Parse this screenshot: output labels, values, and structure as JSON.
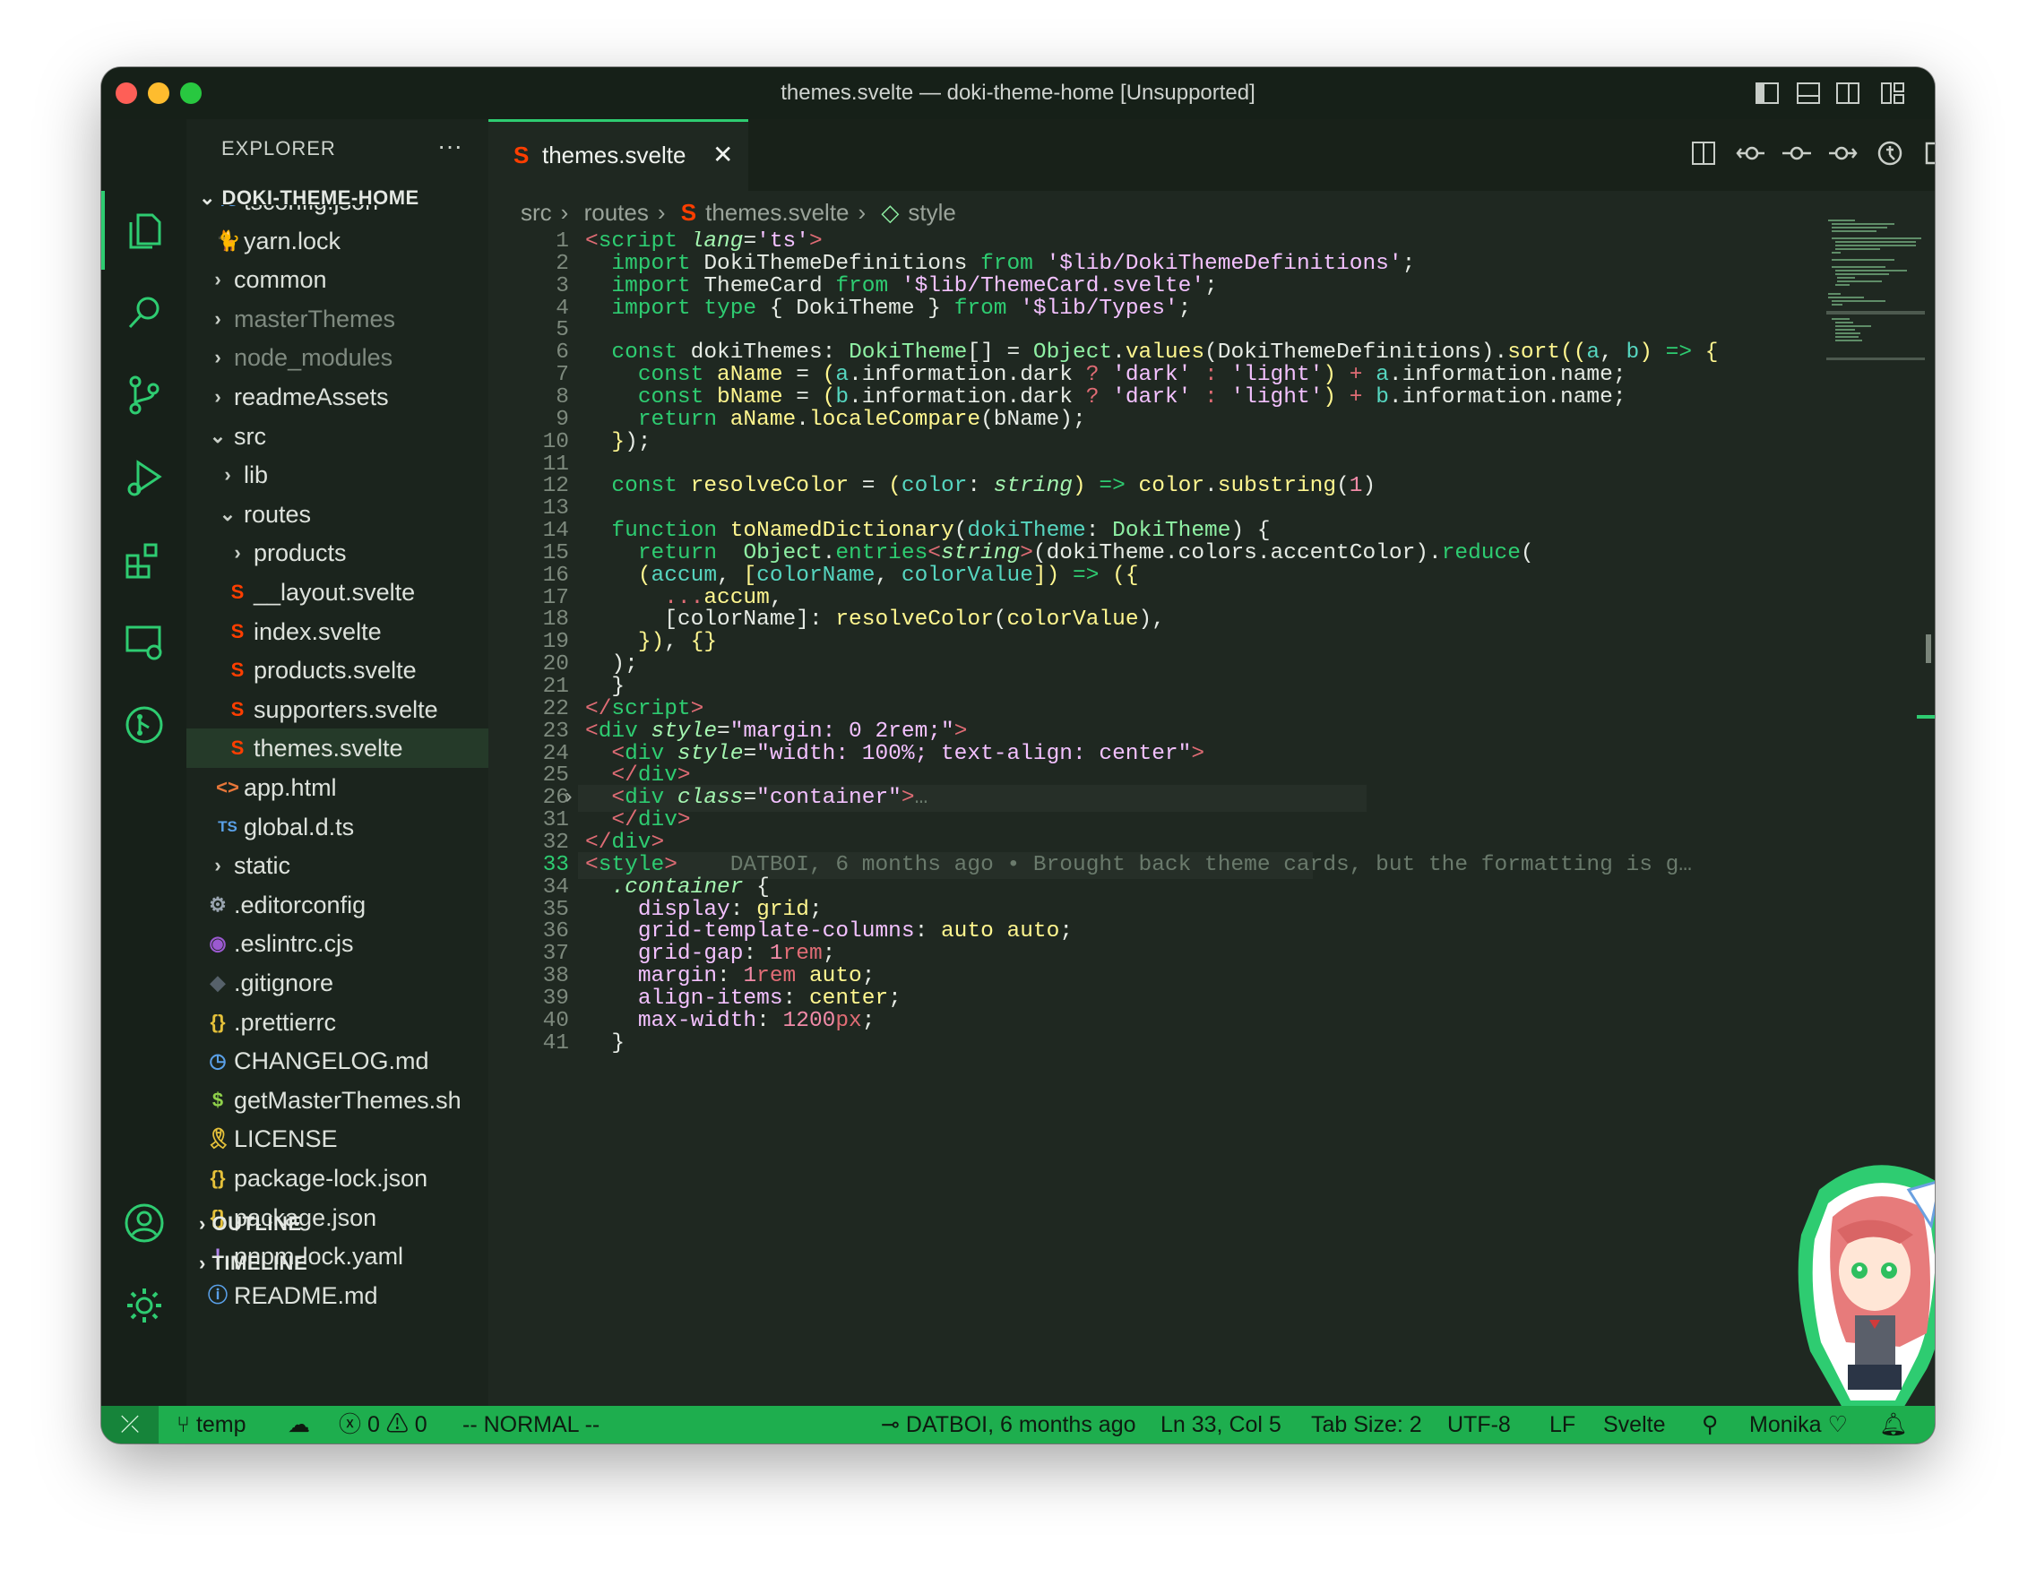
{
  "window": {
    "title": "themes.svelte — doki-theme-home [Unsupported]"
  },
  "colors": {
    "accent": "#2ecc71",
    "status_bar": "#1eae4e",
    "background": "#1f2821"
  },
  "activity_bar": {
    "items": [
      "files-icon",
      "search-icon",
      "source-control-icon",
      "run-debug-icon",
      "extensions-icon",
      "remote-explorer-icon",
      "git-graph-icon"
    ],
    "bottom": [
      "account-icon",
      "settings-gear-icon"
    ]
  },
  "sidebar": {
    "title": "EXPLORER",
    "more": "···",
    "root": "DOKI-THEME-HOME",
    "items": [
      {
        "label": "tsconfig.json",
        "icon": "TS",
        "indent": 1,
        "color": "#5aa0e8"
      },
      {
        "label": "yarn.lock",
        "icon": "🐈",
        "indent": 1,
        "color": "#3c8dd8"
      },
      {
        "label": "common",
        "icon": "›",
        "indent": 0,
        "color": "#c9cfc8"
      },
      {
        "label": "masterThemes",
        "icon": "›",
        "indent": 0,
        "color": "#c9cfc8",
        "dim": true
      },
      {
        "label": "node_modules",
        "icon": "›",
        "indent": 0,
        "color": "#c9cfc8",
        "dim": true
      },
      {
        "label": "readmeAssets",
        "icon": "›",
        "indent": 0,
        "color": "#c9cfc8"
      },
      {
        "label": "src",
        "icon": "⌄",
        "indent": 0,
        "color": "#c9cfc8"
      },
      {
        "label": "lib",
        "icon": "›",
        "indent": 1,
        "color": "#c9cfc8"
      },
      {
        "label": "routes",
        "icon": "⌄",
        "indent": 1,
        "color": "#c9cfc8"
      },
      {
        "label": "products",
        "icon": "›",
        "indent": 2,
        "color": "#c9cfc8"
      },
      {
        "label": "__layout.svelte",
        "icon": "S",
        "indent": 2,
        "color": "#ff3e00"
      },
      {
        "label": "index.svelte",
        "icon": "S",
        "indent": 2,
        "color": "#ff3e00"
      },
      {
        "label": "products.svelte",
        "icon": "S",
        "indent": 2,
        "color": "#ff3e00"
      },
      {
        "label": "supporters.svelte",
        "icon": "S",
        "indent": 2,
        "color": "#ff3e00"
      },
      {
        "label": "themes.svelte",
        "icon": "S",
        "indent": 2,
        "color": "#ff3e00",
        "selected": true
      },
      {
        "label": "app.html",
        "icon": "<>",
        "indent": 1,
        "color": "#e8773a"
      },
      {
        "label": "global.d.ts",
        "icon": "TS",
        "indent": 1,
        "color": "#5aa0e8"
      },
      {
        "label": "static",
        "icon": "›",
        "indent": 0,
        "color": "#c9cfc8"
      },
      {
        "label": ".editorconfig",
        "icon": "⚙",
        "indent": 0,
        "color": "#9aa5b0"
      },
      {
        "label": ".eslintrc.cjs",
        "icon": "◉",
        "indent": 0,
        "color": "#9b59d0"
      },
      {
        "label": ".gitignore",
        "icon": "◆",
        "indent": 0,
        "color": "#56616a"
      },
      {
        "label": ".prettierrc",
        "icon": "{}",
        "indent": 0,
        "color": "#e5c13a"
      },
      {
        "label": "CHANGELOG.md",
        "icon": "◷",
        "indent": 0,
        "color": "#5aa0e8"
      },
      {
        "label": "getMasterThemes.sh",
        "icon": "$",
        "indent": 0,
        "color": "#8fd14a"
      },
      {
        "label": "LICENSE",
        "icon": "🎗",
        "indent": 0,
        "color": "#e5c13a"
      },
      {
        "label": "package-lock.json",
        "icon": "{}",
        "indent": 0,
        "color": "#e5c13a"
      },
      {
        "label": "package.json",
        "icon": "{}",
        "indent": 0,
        "color": "#e5c13a"
      },
      {
        "label": "pnpm-lock.yaml",
        "icon": "!",
        "indent": 0,
        "color": "#b084eb"
      },
      {
        "label": "README.md",
        "icon": "ⓘ",
        "indent": 0,
        "color": "#5aa0e8"
      }
    ],
    "sections": [
      "OUTLINE",
      "TIMELINE"
    ]
  },
  "editor": {
    "tab": {
      "label": "themes.svelte",
      "close": "✕"
    },
    "breadcrumb": [
      "src",
      "routes",
      "themes.svelte",
      "style"
    ],
    "lines": [
      {
        "n": "1",
        "html": "<span class='op'>&lt;</span><span class='tg'>script</span> <span class='at'>lang</span>=<span class='st'>'ts'</span><span class='op'>&gt;</span>"
      },
      {
        "n": "2",
        "html": "  <span class='kw'>import</span> DokiThemeDefinitions <span class='kw'>from</span> <span class='st'>'$lib/DokiThemeDefinitions'</span>;"
      },
      {
        "n": "3",
        "html": "  <span class='kw'>import</span> ThemeCard <span class='kw'>from</span> <span class='st'>'$lib/ThemeCard.svelte'</span>;"
      },
      {
        "n": "4",
        "html": "  <span class='kw'>import</span> <span class='kw'>type</span> { DokiTheme } <span class='kw'>from</span> <span class='st'>'$lib/Types'</span>;"
      },
      {
        "n": "5",
        "html": ""
      },
      {
        "n": "6",
        "html": "  <span class='kw'>const</span> dokiThemes: <span class='ty'>DokiTheme</span>[] = <span class='ty'>Object</span>.<span class='fn'>values</span>(DokiThemeDefinitions).<span class='fn'>sort</span><span class='br'>((</span><span class='pr'>a</span>, <span class='pr'>b</span><span class='br'>)</span> <span class='kw'>=&gt;</span> <span class='br'>{</span>"
      },
      {
        "n": "7",
        "html": "    <span class='kw'>const</span> <span class='fn'>aName</span> = <span class='br'>(</span><span class='pr'>a</span>.information.dark <span class='op'>?</span> <span class='st'>'dark'</span> <span class='op'>:</span> <span class='st'>'light'</span><span class='br'>)</span> <span class='op'>+</span> <span class='pr'>a</span>.information.name;"
      },
      {
        "n": "8",
        "html": "    <span class='kw'>const</span> <span class='fn'>bName</span> = <span class='br'>(</span><span class='pr'>b</span>.information.dark <span class='op'>?</span> <span class='st'>'dark'</span> <span class='op'>:</span> <span class='st'>'light'</span><span class='br'>)</span> <span class='op'>+</span> <span class='pr'>b</span>.information.name;"
      },
      {
        "n": "9",
        "html": "    <span class='kw'>return</span> <span class='fn'>aName</span>.<span class='fn'>localeCompare</span>(bName);"
      },
      {
        "n": "10",
        "html": "  <span class='br'>}</span>);"
      },
      {
        "n": "11",
        "html": ""
      },
      {
        "n": "12",
        "html": "  <span class='kw'>const</span> <span class='fn'>resolveColor</span> = <span class='br'>(</span><span class='pr'>color</span>: <span class='it'>string</span><span class='br'>)</span> <span class='kw'>=&gt;</span> <span class='fn'>color</span>.<span class='fn'>substring</span>(<span class='num'>1</span>)"
      },
      {
        "n": "13",
        "html": ""
      },
      {
        "n": "14",
        "html": "  <span class='kw'>function</span> <span class='fn'>toNamedDictionary</span>(<span class='pr'>dokiTheme</span>: <span class='ty'>DokiTheme</span>) {"
      },
      {
        "n": "15",
        "html": "    <span class='kw'>return</span>  <span class='ty'>Object</span>.<span class='kw'>entries</span><span class='op'>&lt;</span><span class='it'>string</span><span class='op'>&gt;</span>(dokiTheme.colors.accentColor).<span class='kw'>reduce</span>("
      },
      {
        "n": "16",
        "html": "    <span class='br'>(</span><span class='pr'>accum</span>, <span class='br'>[</span><span class='pr'>colorName</span>, <span class='pr'>colorValue</span><span class='br'>])</span> <span class='kw'>=&gt;</span> <span class='br'>({</span>"
      },
      {
        "n": "17",
        "html": "      <span class='op'>...</span><span class='fn'>accum</span>,"
      },
      {
        "n": "18",
        "html": "      [colorName]: <span class='fn'>resolveColor</span>(<span class='fn'>colorValue</span>),"
      },
      {
        "n": "19",
        "html": "    <span class='br'>})</span>, <span class='br'>{}</span>"
      },
      {
        "n": "20",
        "html": "  );"
      },
      {
        "n": "21",
        "html": "  }"
      },
      {
        "n": "22",
        "html": "<span class='op'>&lt;/</span><span class='tg'>script</span><span class='op'>&gt;</span>"
      },
      {
        "n": "23",
        "html": "<span class='op'>&lt;</span><span class='tg'>div</span> <span class='at'>style</span>=<span class='st'>\"margin: 0 2rem;\"</span><span class='op'>&gt;</span>"
      },
      {
        "n": "24",
        "html": "  <span class='op'>&lt;</span><span class='tg'>div</span> <span class='at'>style</span>=<span class='st'>\"width: 100%; text-align: center\"</span><span class='op'>&gt;</span>"
      },
      {
        "n": "25",
        "html": "  <span class='op'>&lt;/</span><span class='tg'>div</span><span class='op'>&gt;</span>"
      },
      {
        "n": "26",
        "html": "  <span class='op'>&lt;</span><span class='tg'>div</span> <span class='at'>class</span>=<span class='st'>\"container\"</span><span class='op'>&gt;</span><span class='cm'>…</span>"
      },
      {
        "n": "31",
        "html": "  <span class='op'>&lt;/</span><span class='tg'>div</span><span class='op'>&gt;</span>"
      },
      {
        "n": "32",
        "html": "<span class='op'>&lt;/</span><span class='tg'>div</span><span class='op'>&gt;</span>"
      },
      {
        "n": "33",
        "html": "<span class='op'>&lt;</span><span class='tg'>style</span><span class='op'>&gt;</span>    <span class='cm'>DATBOI, 6 months ago • Brought back theme cards, but the formatting is g…</span>"
      },
      {
        "n": "34",
        "html": "  <span class='at'>.container</span> {"
      },
      {
        "n": "35",
        "html": "    <span class='css'>display</span>: <span class='fn'>grid</span>;"
      },
      {
        "n": "36",
        "html": "    <span class='css'>grid-template-columns</span>: <span class='fn'>auto</span> <span class='fn'>auto</span>;"
      },
      {
        "n": "37",
        "html": "    <span class='css'>grid-gap</span>: <span class='num'>1</span><span class='op'>rem</span>;"
      },
      {
        "n": "38",
        "html": "    <span class='css'>margin</span>: <span class='num'>1</span><span class='op'>rem</span> <span class='fn'>auto</span>;"
      },
      {
        "n": "39",
        "html": "    <span class='css'>align-items</span>: <span class='fn'>center</span>;"
      },
      {
        "n": "40",
        "html": "    <span class='css'>max-width</span>: <span class='num'>1200</span><span class='op'>px</span>;"
      },
      {
        "n": "41",
        "html": "  }"
      }
    ],
    "current_line": "33"
  },
  "status_bar": {
    "branch": "temp",
    "errors": "0",
    "warnings": "0",
    "mode": "-- NORMAL --",
    "blame": "DATBOI, 6 months ago",
    "position": "Ln 33, Col 5",
    "tab_size": "Tab Size: 2",
    "encoding": "UTF-8",
    "eol": "LF",
    "language": "Svelte",
    "theme": "Monika ♡"
  }
}
